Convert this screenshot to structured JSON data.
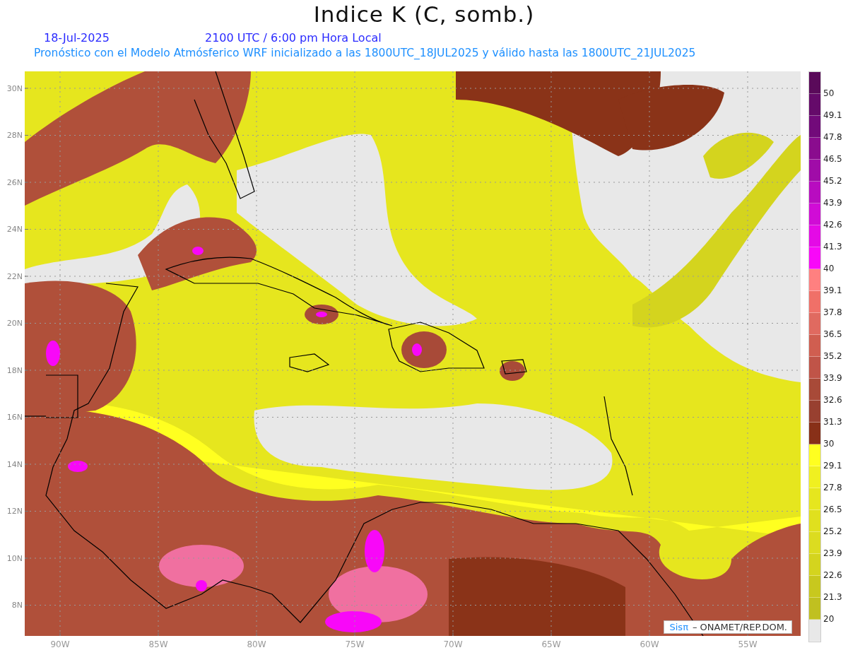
{
  "title": "Indice K (C, somb.)",
  "date": "18-Jul-2025",
  "time": "2100 UTC / 6:00 pm Hora Local",
  "subtitle": "Pronóstico con el Modelo Atmósferico WRF inicializado a las 1800UTC_18JUL2025 y válido hasta las  1800UTC_21JUL2025",
  "map": {
    "y_ticks": [
      "30N",
      "28N",
      "26N",
      "24N",
      "22N",
      "20N",
      "18N",
      "16N",
      "14N",
      "12N",
      "10N",
      "8N"
    ],
    "x_ticks": [
      "90W",
      "85W",
      "80W",
      "75W",
      "70W",
      "65W",
      "60W",
      "55W"
    ],
    "credit": {
      "logo": "Sisπ",
      "text": "– ONAMET/REP.DOM."
    }
  },
  "colorbar": {
    "segments": [
      {
        "color": "#5a0a5a"
      },
      {
        "color": "#650a6a"
      },
      {
        "color": "#720a7a"
      },
      {
        "color": "#8a0c8e"
      },
      {
        "color": "#a00ca8"
      },
      {
        "color": "#b80cc0"
      },
      {
        "color": "#d00cd6"
      },
      {
        "color": "#e40ae6"
      },
      {
        "color": "#f808f8"
      },
      {
        "color": "#ff8080"
      },
      {
        "color": "#f07068"
      },
      {
        "color": "#e06a60"
      },
      {
        "color": "#d05e50"
      },
      {
        "color": "#c05448"
      },
      {
        "color": "#a84a38"
      },
      {
        "color": "#984030"
      },
      {
        "color": "#883018"
      },
      {
        "color": "#ffff20"
      },
      {
        "color": "#f0f020"
      },
      {
        "color": "#e6e61e"
      },
      {
        "color": "#e0e01e"
      },
      {
        "color": "#dcdc20"
      },
      {
        "color": "#d4d41e"
      },
      {
        "color": "#c8c81e"
      },
      {
        "color": "#c0c020"
      },
      {
        "color": "#e8e8e8"
      }
    ],
    "labels": [
      "50",
      "49.1",
      "47.8",
      "46.5",
      "45.2",
      "43.9",
      "42.6",
      "41.3",
      "40",
      "39.1",
      "37.8",
      "36.5",
      "35.2",
      "33.9",
      "32.6",
      "31.3",
      "30",
      "29.1",
      "27.8",
      "26.5",
      "25.2",
      "23.9",
      "22.6",
      "21.3",
      "20"
    ]
  }
}
